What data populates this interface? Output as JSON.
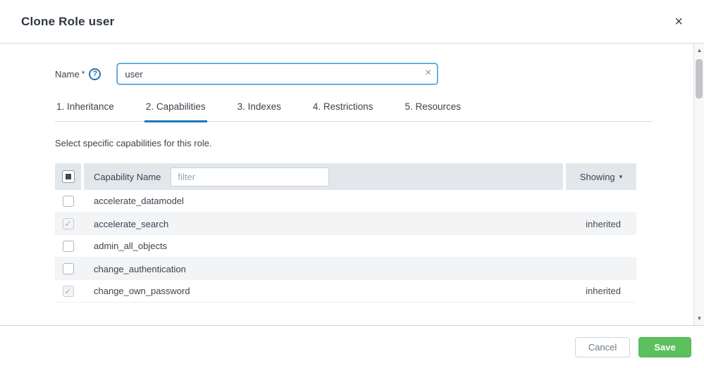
{
  "modal": {
    "title": "Clone Role user",
    "close_icon": "×"
  },
  "form": {
    "name_label": "Name",
    "required_mark": "*",
    "help_icon": "?",
    "name_value": "user",
    "clear_icon": "×"
  },
  "tabs": [
    {
      "label": "1. Inheritance",
      "active": false
    },
    {
      "label": "2. Capabilities",
      "active": true
    },
    {
      "label": "3. Indexes",
      "active": false
    },
    {
      "label": "4. Restrictions",
      "active": false
    },
    {
      "label": "5. Resources",
      "active": false
    }
  ],
  "description": "Select specific capabilities for this role.",
  "table": {
    "header": {
      "select_all_state": "indeterminate",
      "name_column": "Capability Name",
      "filter_placeholder": "filter",
      "showing_label": "Showing",
      "caret_icon": "▾",
      "check_glyph": "✓"
    },
    "rows": [
      {
        "name": "accelerate_datamodel",
        "checked": false,
        "status": ""
      },
      {
        "name": "accelerate_search",
        "checked": true,
        "status": "inherited"
      },
      {
        "name": "admin_all_objects",
        "checked": false,
        "status": ""
      },
      {
        "name": "change_authentication",
        "checked": false,
        "status": ""
      },
      {
        "name": "change_own_password",
        "checked": true,
        "status": "inherited"
      }
    ]
  },
  "scrollbar": {
    "up_icon": "▲",
    "down_icon": "▼"
  },
  "footer": {
    "cancel_label": "Cancel",
    "save_label": "Save"
  },
  "colors": {
    "accent_blue": "#1779c4",
    "focus_blue": "#3a9bd5",
    "save_green": "#5cc05c",
    "header_bg": "#e2e7eb",
    "row_alt_bg": "#f2f4f6",
    "text_dark": "#3c444d"
  }
}
